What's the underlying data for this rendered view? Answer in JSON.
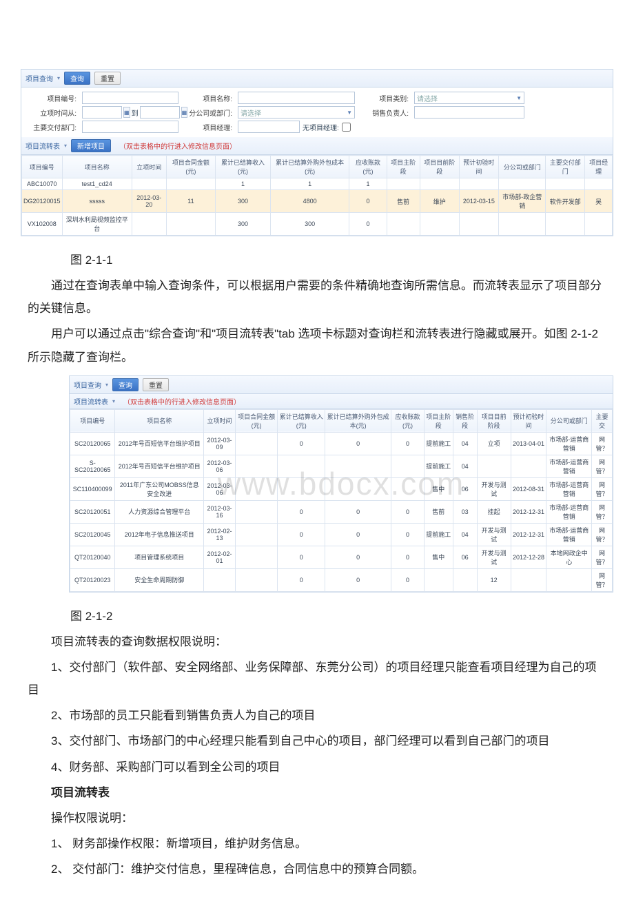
{
  "shot1": {
    "query_bar": {
      "title": "项目查询",
      "btn_search": "查询",
      "btn_reset": "重置",
      "fields": {
        "proj_no": "项目编号:",
        "proj_name": "项目名称:",
        "proj_type": "项目类别:",
        "proj_type_ph": "请选择",
        "date_from": "立项时间从:",
        "date_to": "到",
        "dept": "分公司或部门:",
        "dept_ph": "请选择",
        "sales": "销售负责人:",
        "deliver_dept": "主要交付部门:",
        "pm": "项目经理:",
        "no_pm": "无项目经理:"
      }
    },
    "flow_bar": {
      "title": "项目流转表",
      "btn_new": "新增项目",
      "hint": "（双击表格中的行进入修改信息页面）"
    },
    "headers": [
      "项目编号",
      "项目名称",
      "立项时间",
      "项目合同金额(元)",
      "累计已结算收入(元)",
      "累计已结算外购外包成本(元)",
      "应收账款(元)",
      "项目主阶段",
      "项目目前阶段",
      "预计初验时间",
      "分公司或部门",
      "主要交付部门",
      "项目经理"
    ],
    "rows": [
      {
        "c": [
          "ABC10070",
          "test1_cd24",
          "",
          "",
          "1",
          "1",
          "1",
          "",
          "",
          "",
          "",
          "",
          ""
        ]
      },
      {
        "c": [
          "DG20120015",
          "sssss",
          "2012-03-20",
          "11",
          "300",
          "4800",
          "0",
          "售前",
          "维护",
          "2012-03-15",
          "市场部-政企营销",
          "软件开发部",
          "吴"
        ],
        "sel": true
      },
      {
        "c": [
          "VX102008",
          "深圳水利局视频监控平台",
          "",
          "",
          "300",
          "300",
          "0",
          "",
          "",
          "",
          "",
          "",
          ""
        ]
      }
    ]
  },
  "shot2": {
    "query_bar": {
      "title": "项目查询",
      "btn_search": "查询",
      "btn_reset": "重置"
    },
    "flow_bar": {
      "title": "项目流转表",
      "hint": "（双击表格中的行进入修改信息页面）"
    },
    "headers": [
      "项目编号",
      "项目名称",
      "立项时间",
      "项目合同金额(元)",
      "累计已结算收入(元)",
      "累计已结算外购外包成本(元)",
      "应收账款(元)",
      "项目主阶段",
      "销售阶段",
      "项目目前阶段",
      "预计初验时间",
      "分公司或部门",
      "主要交"
    ],
    "rows": [
      {
        "c": [
          "SC20120065",
          "2012年号百短信平台维护项目",
          "2012-03-09",
          "",
          "0",
          "0",
          "0",
          "提前施工",
          "04",
          "立项",
          "2013-04-01",
          "市场部-运营商营销",
          "网管？"
        ]
      },
      {
        "c": [
          "S-SC20120065",
          "2012年号百短信平台维护项目",
          "2012-03-06",
          "",
          "",
          "",
          "",
          "提前施工",
          "04",
          "",
          "",
          "市场部-运营商营销",
          "网管？"
        ]
      },
      {
        "c": [
          "SC110400099",
          "2011年广东公司MOBSS信息安全改进",
          "2012-03-06",
          "",
          "",
          "",
          "",
          "售中",
          "06",
          "开发与测试",
          "2012-08-31",
          "市场部-运营商营销",
          "网管？"
        ]
      },
      {
        "c": [
          "SC20120051",
          "人力资源综合管理平台",
          "2012-03-16",
          "",
          "0",
          "0",
          "0",
          "售前",
          "03",
          "挂起",
          "2012-12-31",
          "市场部-运营商营销",
          "网管？"
        ]
      },
      {
        "c": [
          "SC20120045",
          "2012年电子信息推送项目",
          "2012-02-13",
          "",
          "0",
          "0",
          "0",
          "提前施工",
          "04",
          "开发与测试",
          "2012-12-31",
          "市场部-运营商营销",
          "网管？"
        ]
      },
      {
        "c": [
          "QT20120040",
          "项目管理系统项目",
          "2012-02-01",
          "",
          "0",
          "0",
          "0",
          "售中",
          "06",
          "开发与测试",
          "2012-12-28",
          "本地网政企中心",
          "网管？"
        ]
      },
      {
        "c": [
          "QT20120023",
          "安全生命周期防御",
          "",
          "",
          "0",
          "0",
          "0",
          "",
          "",
          "12",
          "",
          "",
          "网管？"
        ]
      }
    ]
  },
  "doc": {
    "cap1": "图 2-1-1",
    "p1": "通过在查询表单中输入查询条件，可以根据用户需要的条件精确地查询所需信息。而流转表显示了项目部分的关键信息。",
    "p2": "用户可以通过点击\"综合查询\"和\"项目流转表\"tab 选项卡标题对查询栏和流转表进行隐藏或展开。如图 2-1-2 所示隐藏了查询栏。",
    "cap2": "图 2-1-2",
    "p3": "项目流转表的查询数据权限说明：",
    "p4": "1、交付部门（软件部、安全网络部、业务保障部、东莞分公司）的项目经理只能查看项目经理为自己的项目",
    "p5": "2、市场部的员工只能看到销售负责人为自己的项目",
    "p6": "3、交付部门、市场部门的中心经理只能看到自己中心的项目，部门经理可以看到自己部门的项目",
    "p7": "4、财务部、采购部门可以看到全公司的项目",
    "h1": "项目流转表",
    "p8": "操作权限说明：",
    "p9": "1、 财务部操作权限：新增项目，维护财务信息。",
    "p10": "2、 交付部门：维护交付信息，里程碑信息，合同信息中的预算合同额。"
  }
}
